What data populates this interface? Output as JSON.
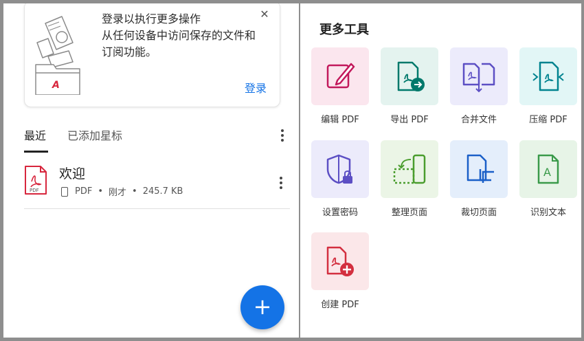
{
  "signin_card": {
    "message": "登录以执行更多操作\n从任何设备中访问保存的文件和\n订阅功能。",
    "close_label": "✕",
    "signin_label": "登录"
  },
  "tabs": {
    "recent": "最近",
    "starred": "已添加星标"
  },
  "recent_files": [
    {
      "name": "欢迎",
      "type": "PDF",
      "time": "刚才",
      "size": "245.7 KB"
    }
  ],
  "fab_label": "+",
  "tools_panel": {
    "title": "更多工具",
    "tools": [
      {
        "label": "编辑 PDF",
        "icon": "edit-pdf-icon",
        "bg": "#fbe6ee",
        "color": "#c2185b"
      },
      {
        "label": "导出 PDF",
        "icon": "export-pdf-icon",
        "bg": "#e4f3ef",
        "color": "#00796b"
      },
      {
        "label": "合并文件",
        "icon": "combine-files-icon",
        "bg": "#ecebfb",
        "color": "#5c4fc4"
      },
      {
        "label": "压缩 PDF",
        "icon": "compress-pdf-icon",
        "bg": "#e2f6f6",
        "color": "#00838f"
      },
      {
        "label": "设置密码",
        "icon": "protect-pdf-icon",
        "bg": "#ecebfb",
        "color": "#5c4fc4"
      },
      {
        "label": "整理页面",
        "icon": "organize-pages-icon",
        "bg": "#ebf5e6",
        "color": "#4a9d2d"
      },
      {
        "label": "裁切页面",
        "icon": "crop-pages-icon",
        "bg": "#e4eefb",
        "color": "#1a5fc8"
      },
      {
        "label": "识别文本",
        "icon": "recognize-text-icon",
        "bg": "#e7f4e7",
        "color": "#3a9a4a"
      },
      {
        "label": "创建 PDF",
        "icon": "create-pdf-icon",
        "bg": "#fbe7e9",
        "color": "#d32f3f"
      }
    ]
  },
  "colors": {
    "accent": "#1473e6",
    "pdf_red": "#d7263d"
  }
}
